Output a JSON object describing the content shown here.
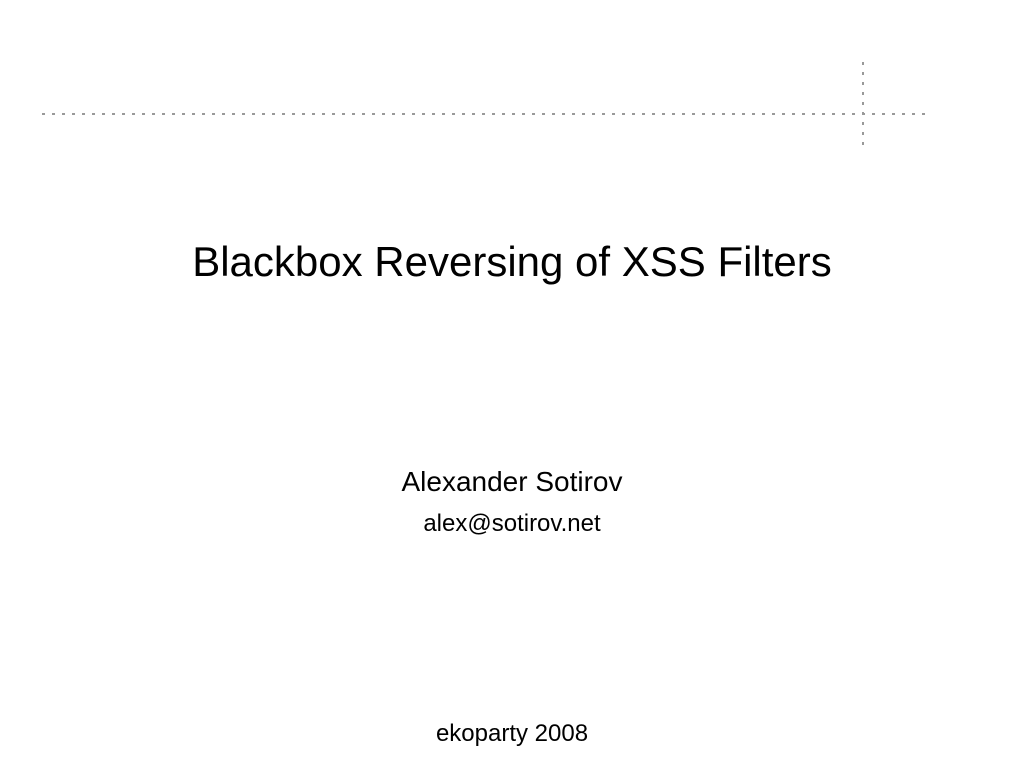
{
  "slide": {
    "title": "Blackbox Reversing of XSS Filters",
    "author": "Alexander Sotirov",
    "email": "alex@sotirov.net",
    "event": "ekoparty 2008"
  }
}
